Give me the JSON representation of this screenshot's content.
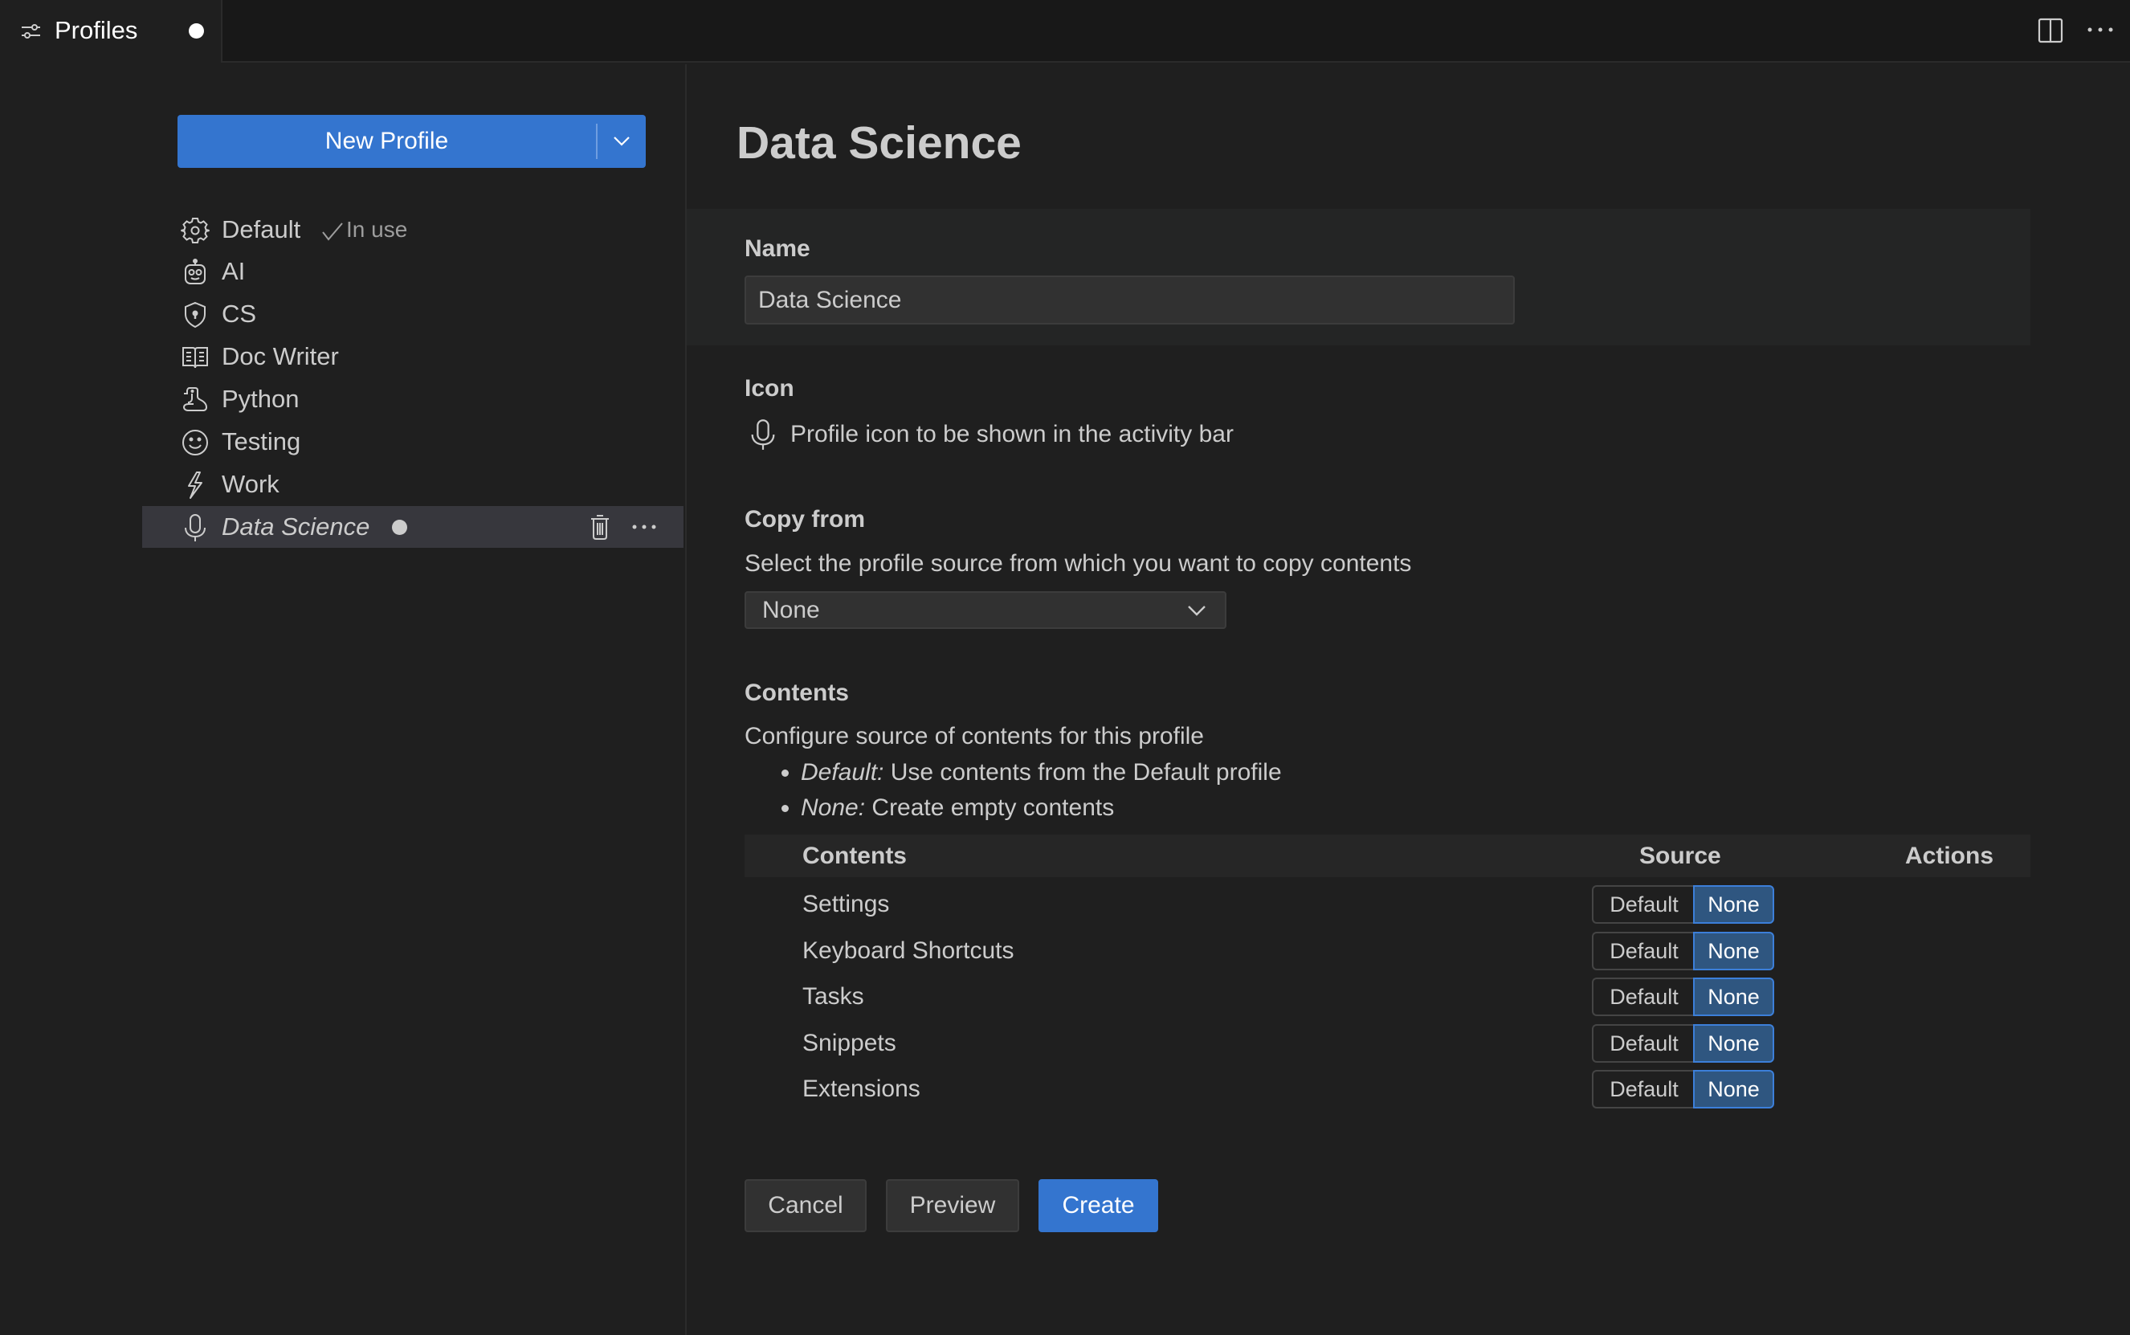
{
  "tab": {
    "label": "Profiles",
    "icon": "settings-sliders-icon",
    "dirty": true
  },
  "titlebar_actions": {
    "split_editor": "split-editor-icon",
    "more": "more-actions-icon"
  },
  "sidebar": {
    "new_profile_label": "New Profile",
    "profiles": [
      {
        "name": "Default",
        "icon": "gear-icon",
        "badge": "In use"
      },
      {
        "name": "AI",
        "icon": "robot-icon"
      },
      {
        "name": "CS",
        "icon": "shield-lock-icon"
      },
      {
        "name": "Doc Writer",
        "icon": "book-icon"
      },
      {
        "name": "Python",
        "icon": "snake-icon"
      },
      {
        "name": "Testing",
        "icon": "smiley-icon"
      },
      {
        "name": "Work",
        "icon": "zap-icon"
      },
      {
        "name": "Data Science",
        "icon": "mic-icon",
        "selected": true,
        "dirty": true
      }
    ]
  },
  "editor": {
    "title": "Data Science",
    "name": {
      "label": "Name",
      "value": "Data Science"
    },
    "icon": {
      "label": "Icon",
      "description": "Profile icon to be shown in the activity bar",
      "current": "mic-icon"
    },
    "copy_from": {
      "label": "Copy from",
      "description": "Select the profile source from which you want to copy contents",
      "selected": "None"
    },
    "contents": {
      "label": "Contents",
      "description": "Configure source of contents for this profile",
      "bullets": [
        {
          "term": "Default:",
          "text": " Use contents from the Default profile"
        },
        {
          "term": "None:",
          "text": " Create empty contents"
        }
      ],
      "table": {
        "headers": {
          "contents": "Contents",
          "source": "Source",
          "actions": "Actions"
        },
        "rows": [
          {
            "name": "Settings",
            "options": [
              "Default",
              "None"
            ],
            "selected": "None"
          },
          {
            "name": "Keyboard Shortcuts",
            "options": [
              "Default",
              "None"
            ],
            "selected": "None"
          },
          {
            "name": "Tasks",
            "options": [
              "Default",
              "None"
            ],
            "selected": "None"
          },
          {
            "name": "Snippets",
            "options": [
              "Default",
              "None"
            ],
            "selected": "None"
          },
          {
            "name": "Extensions",
            "options": [
              "Default",
              "None"
            ],
            "selected": "None"
          }
        ]
      }
    },
    "buttons": {
      "cancel": "Cancel",
      "preview": "Preview",
      "create": "Create"
    }
  },
  "colors": {
    "accent": "#3475cf",
    "selected_toggle": "#2f5680",
    "background": "#1f1f1f"
  }
}
